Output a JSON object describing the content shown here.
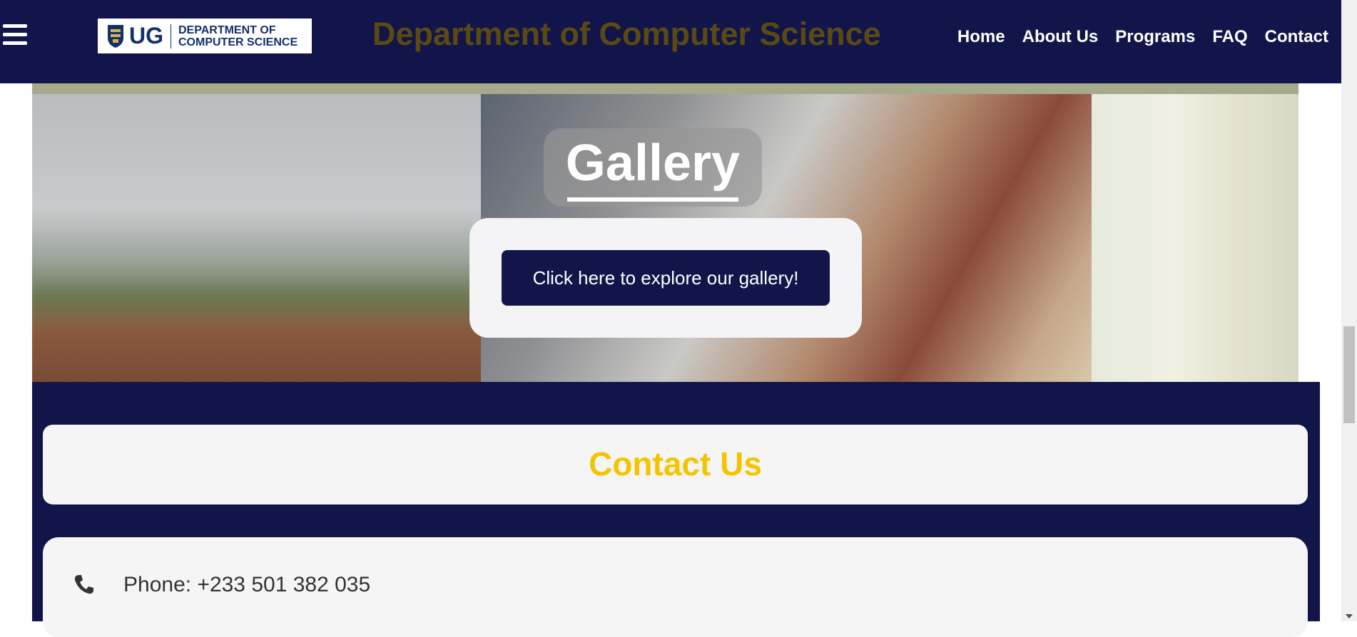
{
  "header": {
    "menu_icon": "hamburger-menu-icon",
    "logo": {
      "crest_icon": "ug-crest-icon",
      "abbr": "UG",
      "dept_line1": "DEPARTMENT OF",
      "dept_line2": "COMPUTER SCIENCE"
    },
    "title": "Department of Computer Science",
    "nav": [
      "Home",
      "About Us",
      "Programs",
      "FAQ",
      "Contact"
    ]
  },
  "gallery": {
    "title": "Gallery",
    "button_label": "Click here to explore our gallery!",
    "photos": [
      "campus-gate-photo",
      "lab-students-photo",
      "classroom-lecture-photo"
    ]
  },
  "contact": {
    "heading": "Contact Us",
    "phone": {
      "icon": "phone-icon",
      "text": "Phone: +233 501 382 035"
    }
  },
  "colors": {
    "navy": "#12154a",
    "title_gold": "#5a4a12",
    "contact_heading": "#f5c400",
    "olive_band": "#a5aa8a"
  }
}
